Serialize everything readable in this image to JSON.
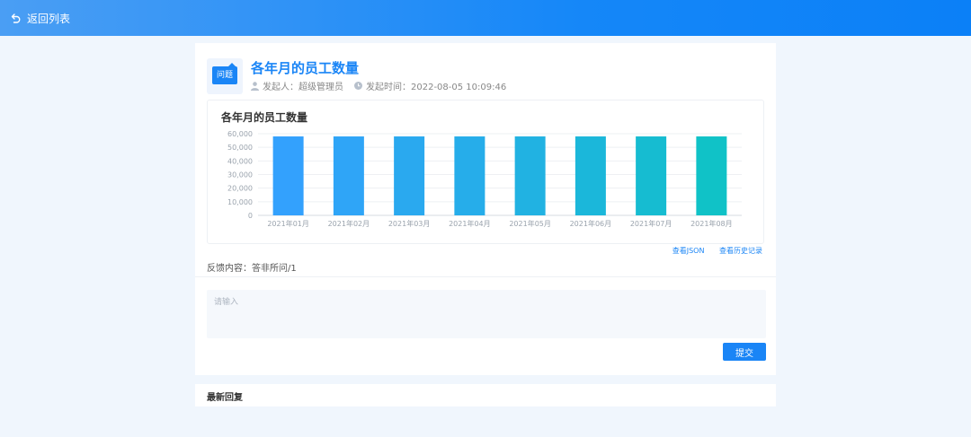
{
  "topbar": {
    "back_label": "返回列表"
  },
  "question": {
    "icon_label": "问题",
    "title": "各年月的员工数量",
    "author_label": "发起人：超级管理员",
    "time_label": "发起时间：2022-08-05 10:09:46"
  },
  "chart_data": {
    "type": "bar",
    "title": "各年月的员工数量",
    "categories": [
      "2021年01月",
      "2021年02月",
      "2021年03月",
      "2021年04月",
      "2021年05月",
      "2021年06月",
      "2021年07月",
      "2021年08月"
    ],
    "values": [
      58000,
      58000,
      58000,
      58000,
      58000,
      58000,
      58000,
      58000
    ],
    "ylim": [
      0,
      60000
    ],
    "yticks": [
      0,
      10000,
      20000,
      30000,
      40000,
      50000,
      60000
    ],
    "ytick_labels": [
      "0",
      "10,000",
      "20,000",
      "30,000",
      "40,000",
      "50,000",
      "60,000"
    ],
    "grid": true,
    "colors": [
      "#33a1fd",
      "#2fa5f7",
      "#2aa9ef",
      "#26adea",
      "#21b2e2",
      "#1bb7da",
      "#16bcd1",
      "#10c2c7"
    ],
    "xlabel": "",
    "ylabel": ""
  },
  "links": {
    "view_json": "查看JSON",
    "view_history": "查看历史记录"
  },
  "feedback": {
    "text": "反馈内容：答非所问/1"
  },
  "reply_input": {
    "placeholder": "请输入",
    "value": ""
  },
  "submit_label": "提交",
  "latest_replies": {
    "title": "最新回复"
  }
}
